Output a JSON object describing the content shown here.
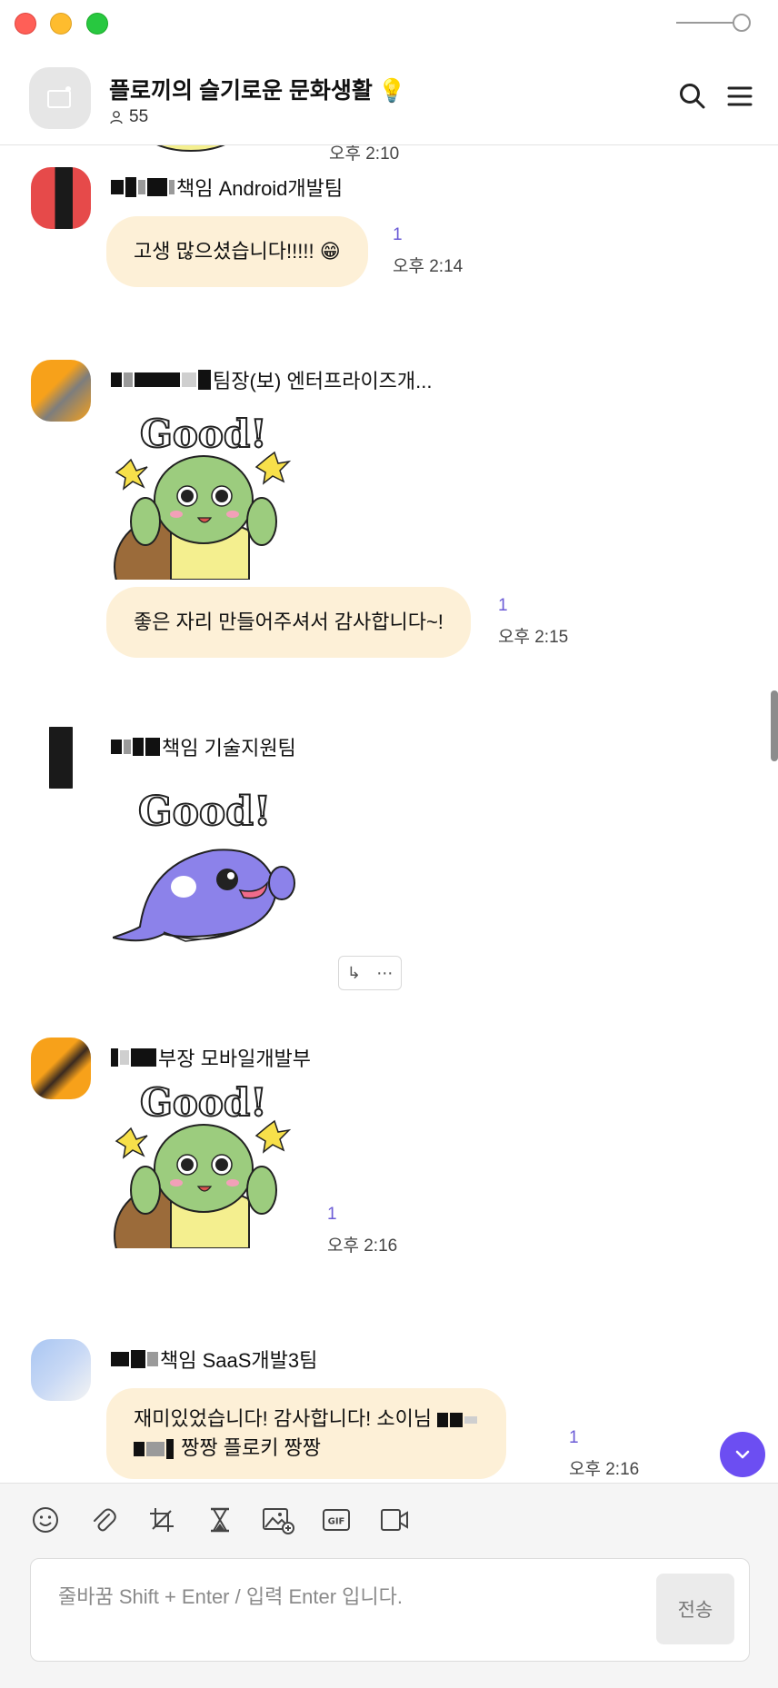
{
  "window": {
    "zoom_slider": "zoom"
  },
  "header": {
    "title": "플로끼의 슬기로운 문화생활",
    "title_emoji": "💡",
    "member_count": "55"
  },
  "messages": [
    {
      "id": "m0",
      "time": "오후 2:10"
    },
    {
      "id": "m1",
      "role_team": "책임 Android개발팀",
      "text": "고생 많으셨습니다!!!!! 😁",
      "read_count": "1",
      "time": "오후 2:14"
    },
    {
      "id": "m2",
      "role_team": "팀장(보) 엔터프라이즈개...",
      "sticker": "good-turtle",
      "sticker_text": "Good!",
      "text": "좋은 자리 만들어주셔서 감사합니다~!",
      "read_count": "1",
      "time": "오후 2:15"
    },
    {
      "id": "m3",
      "role_team": "책임 기술지원팀",
      "sticker": "good-orca",
      "sticker_text": "Good!"
    },
    {
      "id": "m4",
      "role_team": "부장 모바일개발부",
      "sticker": "good-turtle",
      "sticker_text": "Good!",
      "read_count": "1",
      "time": "오후 2:16"
    },
    {
      "id": "m5",
      "role_team": "책임 SaaS개발3팀",
      "text_line1": "재미있었습니다! 감사합니다! 소이님",
      "text_line2": "짱짱 플로키 짱짱",
      "read_count": "1",
      "time": "오후 2:16"
    }
  ],
  "composer": {
    "placeholder": "줄바꿈 Shift + Enter / 입력 Enter 입니다.",
    "value": "",
    "send_label": "전송",
    "tools": [
      "emoji-icon",
      "attach-icon",
      "crop-icon",
      "hourglass-icon",
      "image-add-icon",
      "gif-icon",
      "video-icon"
    ],
    "gif_label": "GIF"
  },
  "colors": {
    "bubble": "#fdf0d7",
    "accent": "#6c4ef2",
    "read_count": "#6b5bd6"
  }
}
